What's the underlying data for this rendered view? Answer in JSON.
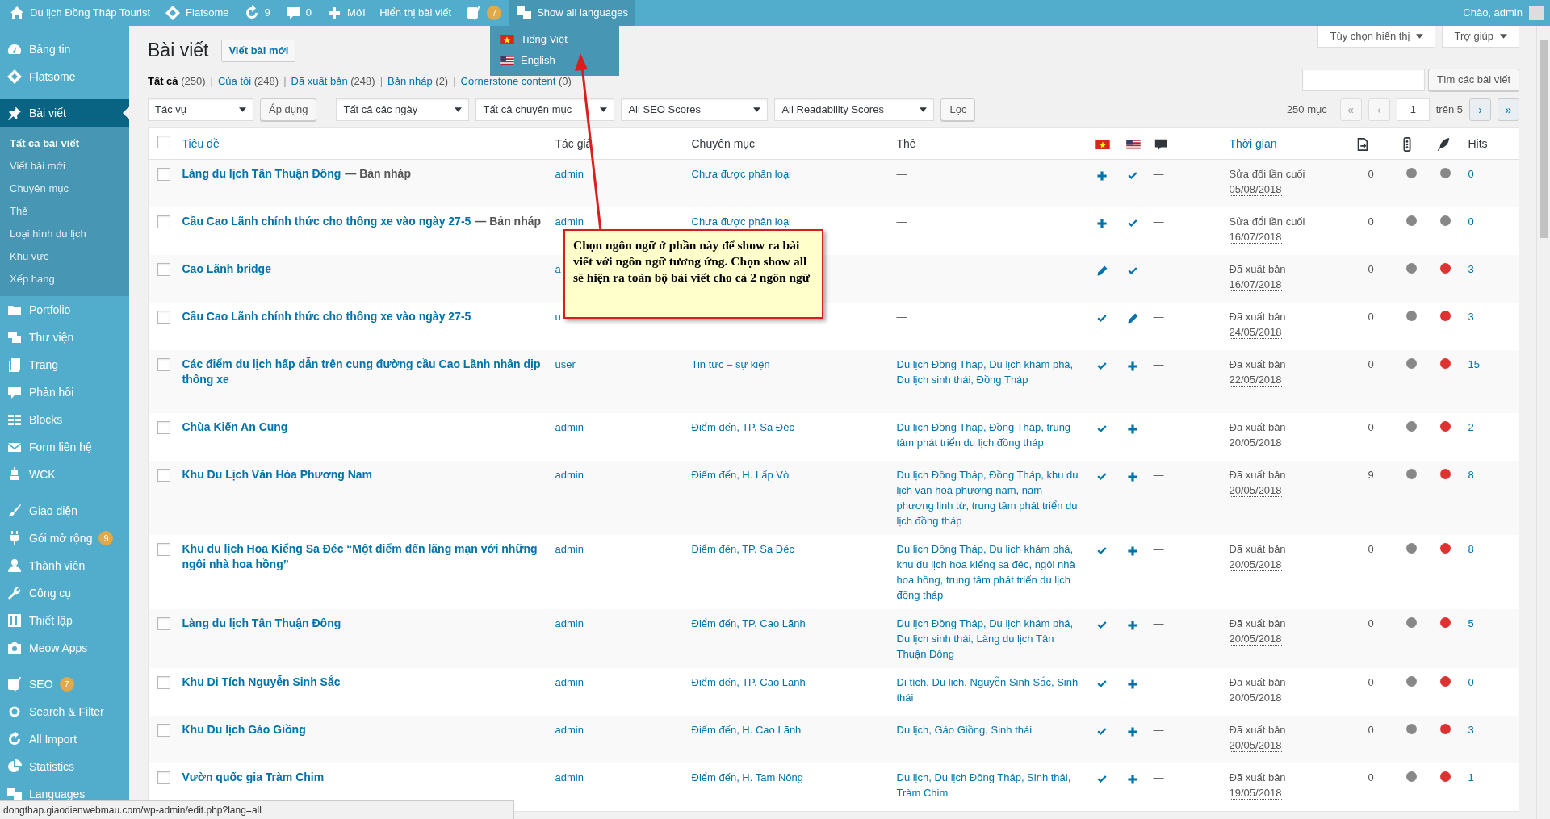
{
  "admin_bar": {
    "items": [
      {
        "label": "Du lịch Đồng Tháp Tourist",
        "highlighted": false
      },
      {
        "label": "Flatsome",
        "highlighted": false
      },
      {
        "label": "9",
        "highlighted": false
      },
      {
        "label": "0",
        "highlighted": false
      },
      {
        "label": "Mới",
        "highlighted": false
      },
      {
        "label": "Hiển thị bài viết",
        "highlighted": false
      },
      {
        "badge": "7",
        "highlighted": false
      },
      {
        "label": "Show all languages",
        "highlighted": true
      }
    ],
    "greeting": "Chào, admin",
    "language_menu": [
      {
        "label": "Tiếng Việt"
      },
      {
        "label": "English"
      }
    ]
  },
  "sidebar": {
    "groups": [
      [
        {
          "label": "Bảng tin",
          "selected": false
        },
        {
          "label": "Flatsome",
          "selected": false
        }
      ],
      [
        {
          "label": "Bài viết",
          "selected": true,
          "children": [
            {
              "label": "Tất cả bài viết",
              "selected": true
            },
            {
              "label": "Viết bài mới",
              "selected": false
            },
            {
              "label": "Chuyên mục",
              "selected": false
            },
            {
              "label": "Thẻ",
              "selected": false
            },
            {
              "label": "Loại hình du lịch",
              "selected": false
            },
            {
              "label": "Khu vực",
              "selected": false
            },
            {
              "label": "Xếp hạng",
              "selected": false
            }
          ]
        },
        {
          "label": "Portfolio",
          "selected": false
        },
        {
          "label": "Thư viện",
          "selected": false
        },
        {
          "label": "Trang",
          "selected": false
        },
        {
          "label": "Phản hồi",
          "selected": false
        },
        {
          "label": "Blocks",
          "selected": false
        },
        {
          "label": "Form liên hệ",
          "selected": false
        },
        {
          "label": "WCK",
          "selected": false
        }
      ],
      [
        {
          "label": "Giao diện",
          "selected": false
        },
        {
          "label": "Gói mở rộng",
          "badge": "9",
          "selected": false
        },
        {
          "label": "Thành viên",
          "selected": false
        },
        {
          "label": "Công cụ",
          "selected": false
        },
        {
          "label": "Thiết lập",
          "selected": false
        },
        {
          "label": "Meow Apps",
          "selected": false
        }
      ],
      [
        {
          "label": "SEO",
          "badge": "7",
          "selected": false
        },
        {
          "label": "Search & Filter",
          "selected": false
        },
        {
          "label": "All Import",
          "selected": false
        },
        {
          "label": "Statistics",
          "selected": false
        },
        {
          "label": "Languages",
          "selected": false
        }
      ]
    ]
  },
  "screen_tabs": [
    "Tùy chọn hiển thị",
    "Trợ giúp"
  ],
  "page_title": "Bài viết",
  "add_new": "Viết bài mới",
  "views": [
    {
      "label": "Tất cả",
      "count": "(250)",
      "selected": true,
      "separator": "|"
    },
    {
      "label": "Của tôi",
      "count": "(248)",
      "selected": false,
      "separator": "|"
    },
    {
      "label": "Đã xuất bản",
      "count": "(248)",
      "selected": false,
      "separator": "|"
    },
    {
      "label": "Bản nháp",
      "count": "(2)",
      "selected": false,
      "separator": "|"
    },
    {
      "label": "Cornerstone content",
      "count": "(0)",
      "selected": false
    }
  ],
  "search": {
    "button": "Tìm các bài viết"
  },
  "filters": [
    {
      "kind": "select",
      "label": "Tác vụ"
    },
    {
      "kind": "button",
      "label": "Áp dụng"
    },
    {
      "kind": "select",
      "label": "Tất cả các ngày"
    },
    {
      "kind": "select",
      "label": "Tất cả chuyên mục"
    },
    {
      "kind": "select",
      "label": "All SEO Scores"
    },
    {
      "kind": "select",
      "label": "All Readability Scores"
    },
    {
      "kind": "button",
      "label": "Lọc"
    }
  ],
  "pagination": {
    "count": "250 mục",
    "buttons": [
      {
        "label": "«",
        "disabled": true
      },
      {
        "label": "‹",
        "disabled": true
      }
    ],
    "page": "1",
    "of": "trên 5",
    "next_buttons": [
      {
        "label": "›",
        "disabled": false
      },
      {
        "label": "»",
        "disabled": false
      }
    ]
  },
  "table": {
    "select_all_checked": false,
    "columns": [
      {
        "label": "Tiêu đề",
        "sortable": true
      },
      {
        "label": "Tác giả",
        "sortable": false
      },
      {
        "label": "Chuyên mục",
        "sortable": false
      },
      {
        "label": "Thẻ",
        "sortable": false
      },
      {
        "label": "Thời gian",
        "sortable": true
      },
      {
        "label": "Hits",
        "sortable": false
      }
    ],
    "rows": [
      {
        "checked": false,
        "title": "Làng du lịch Tân Thuận Đông",
        "state": "— Bản nháp",
        "author": "admin",
        "category": "Chưa được phân loại",
        "tags": "—",
        "tags_link": false,
        "langs": [
          {
            "kind": "add"
          },
          {
            "kind": "check"
          }
        ],
        "comments": "—",
        "status": "Sửa đổi lần cuối",
        "date": "05/08/2018",
        "links": "0",
        "seo_dot": {
          "color": "#888888"
        },
        "readability_dot": {
          "color": "#888888"
        },
        "hits": "0"
      },
      {
        "checked": false,
        "title": "Cầu Cao Lãnh chính thức cho thông xe vào ngày 27-5",
        "state": "— Bản nháp",
        "author": "admin",
        "category": "Chưa được phân loại",
        "tags": "—",
        "tags_link": false,
        "langs": [
          {
            "kind": "add"
          },
          {
            "kind": "check"
          }
        ],
        "comments": "—",
        "status": "Sửa đổi lần cuối",
        "date": "16/07/2018",
        "links": "0",
        "seo_dot": {
          "color": "#888888"
        },
        "readability_dot": {
          "color": "#888888"
        },
        "hits": "0"
      },
      {
        "checked": false,
        "title": "Cao Lãnh bridge",
        "author": "a",
        "tags": "—",
        "tags_link": false,
        "langs": [
          {
            "kind": "edit"
          },
          {
            "kind": "check"
          }
        ],
        "comments": "—",
        "status": "Đã xuất bản",
        "date": "16/07/2018",
        "links": "0",
        "seo_dot": {
          "color": "#888888"
        },
        "readability_dot": {
          "color": "#dc3232"
        },
        "hits": "3"
      },
      {
        "checked": false,
        "title": "Cầu Cao Lãnh chính thức cho thông xe vào ngày 27-5",
        "author": "u",
        "tags": "—",
        "tags_link": false,
        "langs": [
          {
            "kind": "check"
          },
          {
            "kind": "edit"
          }
        ],
        "comments": "—",
        "status": "Đã xuất bản",
        "date": "24/05/2018",
        "links": "0",
        "seo_dot": {
          "color": "#888888"
        },
        "readability_dot": {
          "color": "#dc3232"
        },
        "hits": "3"
      },
      {
        "checked": false,
        "title": "Các điểm du lịch hấp dẫn trên cung đường cầu Cao Lãnh nhân dịp thông xe",
        "author": "user",
        "category": "Tin tức – sự kiện",
        "tags": "Du lịch Đồng Tháp, Du lịch khám phá, Du lịch sinh thái, Đồng Tháp",
        "tags_link": true,
        "langs": [
          {
            "kind": "check"
          },
          {
            "kind": "add"
          }
        ],
        "comments": "—",
        "status": "Đã xuất bản",
        "date": "22/05/2018",
        "links": "0",
        "seo_dot": {
          "color": "#888888"
        },
        "readability_dot": {
          "color": "#dc3232"
        },
        "hits": "15"
      },
      {
        "checked": false,
        "title": "Chùa Kiến An Cung",
        "author": "admin",
        "category": "Điểm đến, TP. Sa Đéc",
        "tags": "Du lịch Đồng Tháp, Đồng Tháp, trung tâm phát triển du lịch đồng tháp",
        "tags_link": true,
        "langs": [
          {
            "kind": "check"
          },
          {
            "kind": "add"
          }
        ],
        "comments": "—",
        "status": "Đã xuất bản",
        "date": "20/05/2018",
        "links": "0",
        "seo_dot": {
          "color": "#888888"
        },
        "readability_dot": {
          "color": "#dc3232"
        },
        "hits": "2"
      },
      {
        "checked": false,
        "title": "Khu Du Lịch Văn Hóa Phương Nam",
        "author": "admin",
        "category": "Điểm đến, H. Lấp Vò",
        "tags": "Du lịch Đồng Tháp, Đồng Tháp, khu du lịch văn hoá phương nam, nam phương linh từ, trung tâm phát triển du lịch đồng tháp",
        "tags_link": true,
        "langs": [
          {
            "kind": "check"
          },
          {
            "kind": "add"
          }
        ],
        "comments": "—",
        "status": "Đã xuất bản",
        "date": "20/05/2018",
        "links": "9",
        "seo_dot": {
          "color": "#888888"
        },
        "readability_dot": {
          "color": "#dc3232"
        },
        "hits": "8"
      },
      {
        "checked": false,
        "title": "Khu du lịch Hoa Kiểng Sa Đéc “Một điểm đến lãng mạn với những ngôi nhà hoa hồng”",
        "author": "admin",
        "category": "Điểm đến, TP. Sa Đéc",
        "tags": "Du lịch Đồng Tháp, Du lịch khám phá, khu du lịch hoa kiểng sa đéc, ngôi nhà hoa hồng, trung tâm phát triển du lịch đồng tháp",
        "tags_link": true,
        "langs": [
          {
            "kind": "check"
          },
          {
            "kind": "add"
          }
        ],
        "comments": "—",
        "status": "Đã xuất bản",
        "date": "20/05/2018",
        "links": "0",
        "seo_dot": {
          "color": "#888888"
        },
        "readability_dot": {
          "color": "#dc3232"
        },
        "hits": "8"
      },
      {
        "checked": false,
        "title": "Làng du lịch Tân Thuận Đông",
        "author": "admin",
        "category": "Điểm đến, TP. Cao Lãnh",
        "tags": "Du lịch Đồng Tháp, Du lịch khám phá, Du lịch sinh thái, Làng du lịch Tân Thuận Đông",
        "tags_link": true,
        "langs": [
          {
            "kind": "check"
          },
          {
            "kind": "add"
          }
        ],
        "comments": "—",
        "status": "Đã xuất bản",
        "date": "20/05/2018",
        "links": "0",
        "seo_dot": {
          "color": "#888888"
        },
        "readability_dot": {
          "color": "#dc3232"
        },
        "hits": "5"
      },
      {
        "checked": false,
        "title": "Khu Di Tích Nguyễn Sinh Sắc",
        "author": "admin",
        "category": "Điểm đến, TP. Cao Lãnh",
        "tags": "Di tích, Du lịch, Nguyễn Sinh Sắc, Sinh thái",
        "tags_link": true,
        "langs": [
          {
            "kind": "check"
          },
          {
            "kind": "add"
          }
        ],
        "comments": "—",
        "status": "Đã xuất bản",
        "date": "20/05/2018",
        "links": "0",
        "seo_dot": {
          "color": "#888888"
        },
        "readability_dot": {
          "color": "#dc3232"
        },
        "hits": "0"
      },
      {
        "checked": false,
        "title": "Khu Du lịch Gáo Giồng",
        "author": "admin",
        "category": "Điểm đến, H. Cao Lãnh",
        "tags": "Du lịch, Gáo Giồng, Sinh thái",
        "tags_link": true,
        "langs": [
          {
            "kind": "check"
          },
          {
            "kind": "add"
          }
        ],
        "comments": "—",
        "status": "Đã xuất bản",
        "date": "20/05/2018",
        "links": "0",
        "seo_dot": {
          "color": "#888888"
        },
        "readability_dot": {
          "color": "#dc3232"
        },
        "hits": "3"
      },
      {
        "checked": false,
        "title": "Vườn quốc gia Tràm Chim",
        "author": "admin",
        "category": "Điểm đến, H. Tam Nông",
        "tags": "Du lịch, Du lịch Đồng Tháp, Sinh thái, Tràm Chim",
        "tags_link": true,
        "langs": [
          {
            "kind": "check"
          },
          {
            "kind": "add"
          }
        ],
        "comments": "—",
        "status": "Đã xuất bản",
        "date": "19/05/2018",
        "links": "0",
        "seo_dot": {
          "color": "#888888"
        },
        "readability_dot": {
          "color": "#dc3232"
        },
        "hits": "1"
      }
    ]
  },
  "annotation": {
    "text": "Chọn ngôn ngữ ở phần này để show ra bài viết với ngôn ngữ tương ứng. Chọn show all sẽ hiện ra toàn bộ bài viết cho cả 2 ngôn ngữ"
  },
  "status_bar": "dongthap.giaodienwebmau.com/wp-admin/edit.php?lang=all"
}
